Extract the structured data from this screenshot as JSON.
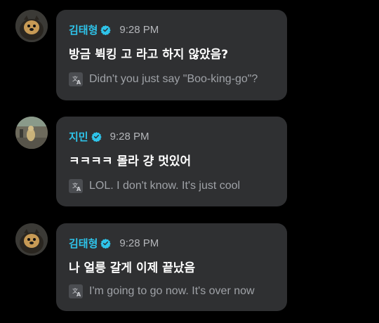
{
  "messages": [
    {
      "author": "김태형",
      "time": "9:28 PM",
      "text": "방금 뷕킹 고 라고 하지 않았음?",
      "translation": "Didn't you just say \"Boo-king-go\"?"
    },
    {
      "author": "지민",
      "time": "9:28 PM",
      "text": "ㅋㅋㅋㅋ 몰라 걍 멋있어",
      "translation": "LOL. I don't know. It's just cool"
    },
    {
      "author": "김태형",
      "time": "9:28 PM",
      "text": "나 얼릉 갈게 이제 끝났음",
      "translation": "I'm going to go now. It's over now"
    }
  ],
  "icons": {
    "verified": "verified-badge-icon",
    "translate": "translate-icon"
  },
  "colors": {
    "background": "#000000",
    "bubble": "#2f3032",
    "author_name": "#2ec4ea",
    "verified_badge": "#2ec4ea",
    "timestamp": "#b4b6ba",
    "message_text": "#ffffff",
    "translation_text": "#9fa2a7"
  }
}
